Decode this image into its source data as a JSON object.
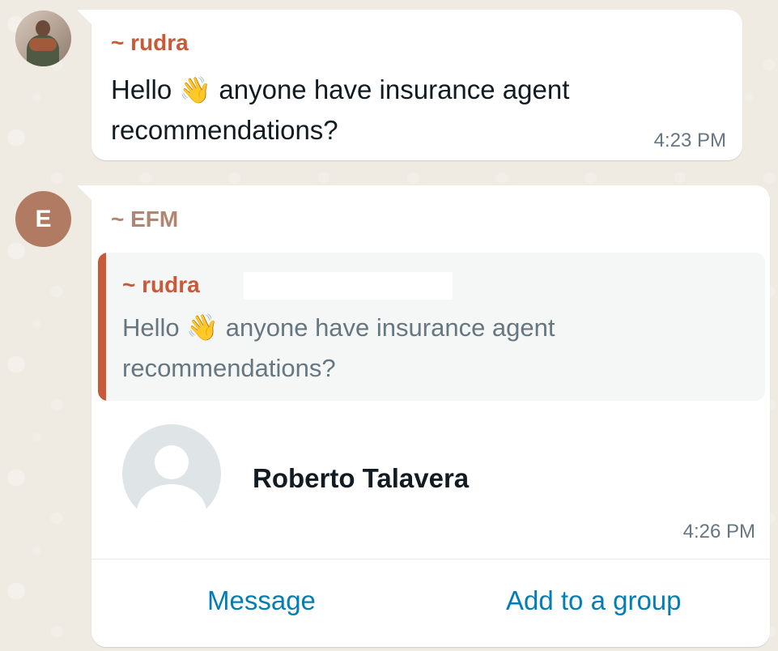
{
  "messages": [
    {
      "sender": "~ rudra",
      "avatar": "profile-photo",
      "text_before_emoji": "Hello",
      "emoji": "👋",
      "text_after_emoji": "anyone have insurance agent recommendations?",
      "time": "4:23 PM"
    },
    {
      "sender": "~ EFM",
      "avatar_letter": "E",
      "quoted": {
        "sender": "~ rudra",
        "text_before_emoji": "Hello",
        "emoji": "👋",
        "text_after_emoji": "anyone have insurance agent recommendations?"
      },
      "contact": {
        "name": "Roberto Talavera",
        "avatar": "default-person-icon"
      },
      "time": "4:26 PM",
      "actions": {
        "message": "Message",
        "add_to_group": "Add to a group"
      }
    }
  ],
  "colors": {
    "wallpaper": "#efeae2",
    "bubble": "#ffffff",
    "rudra_name": "#c85a3a",
    "efm_name": "#b08672",
    "avatar_letter_bg": "#b07a63",
    "link": "#027eb5",
    "timestamp": "#667781",
    "quote_bg": "#f5f6f6"
  }
}
